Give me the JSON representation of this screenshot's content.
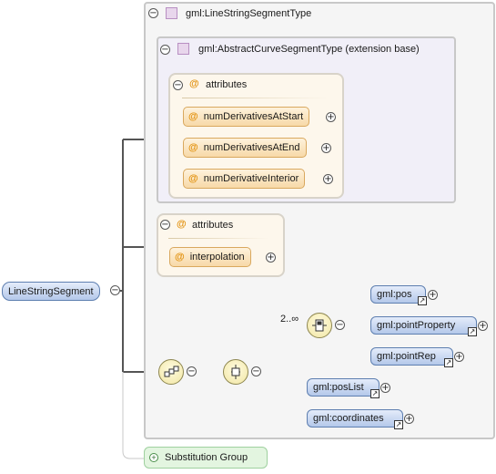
{
  "root_element": {
    "label": "LineStringSegment"
  },
  "type_panel": {
    "label": "gml:LineStringSegmentType"
  },
  "base_panel": {
    "label": "gml:AbstractCurveSegmentType (extension base)"
  },
  "base_attributes": {
    "label": "attributes",
    "items": [
      "numDerivativesAtStart",
      "numDerivativesAtEnd",
      "numDerivativeInterior"
    ]
  },
  "own_attributes": {
    "label": "attributes",
    "items": [
      "interpolation"
    ]
  },
  "multiplicity": "2..∞",
  "choice_elements": [
    "gml:pos",
    "gml:pointProperty",
    "gml:pointRep"
  ],
  "sequence_elements": [
    "gml:posList",
    "gml:coordinates"
  ],
  "substitution_group": {
    "label": "Substitution Group"
  },
  "colors": {
    "element_fill": "#b4c8ea",
    "attribute_fill": "#f7d9a8",
    "compositor_fill": "#f1e6a3",
    "substitution_fill": "#e3f5e0"
  }
}
